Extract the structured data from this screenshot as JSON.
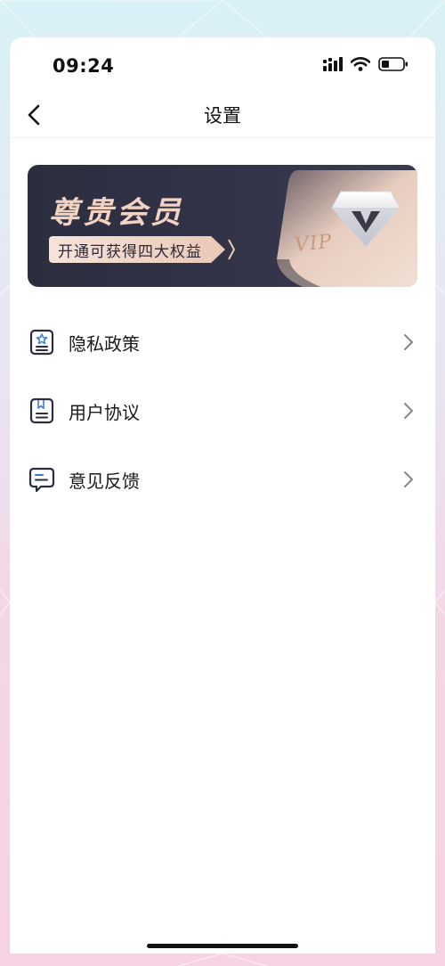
{
  "status_bar": {
    "time": "09:24",
    "icons": [
      "signal-icon",
      "wifi-icon",
      "battery-icon"
    ]
  },
  "nav": {
    "title": "设置",
    "back_icon": "chevron-left-icon"
  },
  "vip_banner": {
    "title": "尊贵会员",
    "subtitle": "开通可获得四大权益",
    "card_text": "VIP",
    "colors": {
      "background": "#2e2f42",
      "title": "#f2d2c0",
      "pill": "#f3dcd0"
    }
  },
  "menu": {
    "items": [
      {
        "label": "隐私政策",
        "icon": "privacy-policy-icon"
      },
      {
        "label": "用户协议",
        "icon": "user-agreement-icon"
      },
      {
        "label": "意见反馈",
        "icon": "feedback-icon"
      }
    ],
    "chevron_icon": "chevron-right-icon",
    "icon_color": "#2b2f3d",
    "accent_color": "#3a7bd5"
  }
}
